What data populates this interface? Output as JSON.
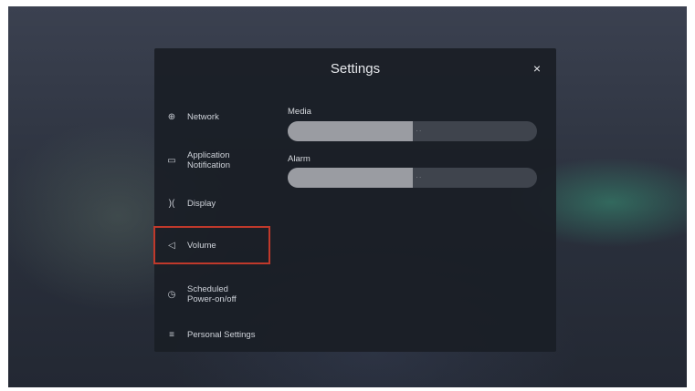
{
  "dialog": {
    "title": "Settings",
    "close_glyph": "×"
  },
  "sidebar": {
    "items": [
      {
        "label": "Network",
        "icon": "globe-icon",
        "glyph": "⊕",
        "selected": false
      },
      {
        "label": "Application\nNotification",
        "icon": "notification-icon",
        "glyph": "▭",
        "selected": false
      },
      {
        "label": "Display",
        "icon": "display-icon",
        "glyph": ")(",
        "selected": false
      },
      {
        "label": "Volume",
        "icon": "speaker-icon",
        "glyph": "◁",
        "selected": true
      },
      {
        "label": "Scheduled\nPower-on/off",
        "icon": "clock-icon",
        "glyph": "◷",
        "selected": false
      },
      {
        "label": "Personal Settings",
        "icon": "menu-icon",
        "glyph": "≡",
        "selected": false
      }
    ]
  },
  "volume": {
    "media": {
      "label": "Media",
      "level": 0.5,
      "value_text": "· ·"
    },
    "alarm": {
      "label": "Alarm",
      "level": 0.5,
      "value_text": "· ·"
    }
  },
  "colors": {
    "selection_outline": "#c0392b",
    "slider_fill": "#9a9ca2",
    "slider_track": "#3f444d"
  }
}
